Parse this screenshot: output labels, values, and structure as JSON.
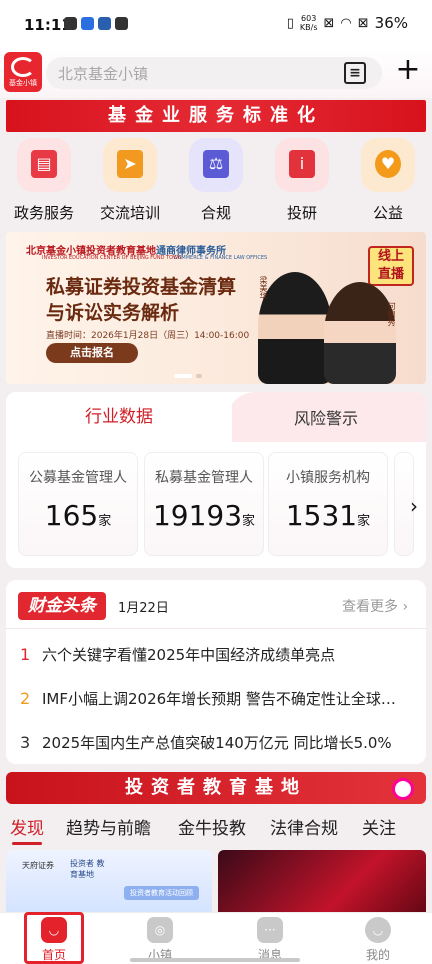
{
  "status_bar": {
    "time": "11:11",
    "net_speed_top": "603",
    "net_speed_unit": "KB/s",
    "battery": "36%"
  },
  "header": {
    "logo_text": "基金小镇",
    "search_placeholder": "北京基金小镇",
    "scan_glyph": "≡",
    "plus_glyph": "+"
  },
  "service_banner": "基金业服务标准化",
  "quick_links": [
    {
      "label": "政务服务",
      "icon": "document-person-icon",
      "color": "#e83a44"
    },
    {
      "label": "交流培训",
      "icon": "blackboard-icon",
      "color": "#f19a1f"
    },
    {
      "label": "合规",
      "icon": "scale-shield-icon",
      "color": "#5b5bd6"
    },
    {
      "label": "投研",
      "icon": "book-info-icon",
      "color": "#e2323c"
    },
    {
      "label": "公益",
      "icon": "heart-icon",
      "color": "#f39a1b"
    }
  ],
  "promo": {
    "org_left": "北京基金小镇投资者教育基地",
    "org_left_sub": "INVESTOR EDUCATION CENTER OF BEIJING FUND TOWN",
    "org_right": "通商律师事务所",
    "org_right_sub": "COMMERCE & FINANCE LAW OFFICES",
    "title_line1": "私募证券投资基金清算",
    "title_line2": "与诉讼实务解析",
    "date_line": "直播时间：2026年1月28日（周三）14:00-16:00",
    "cta": "点击报名",
    "badge": "线上 直播",
    "speaker1": "梁美华",
    "speaker2": "何锦秀"
  },
  "industry": {
    "tab_active": "行业数据",
    "tab_other": "风险警示",
    "stats": [
      {
        "label": "公募基金管理人",
        "value": "165",
        "unit": "家"
      },
      {
        "label": "私募基金管理人",
        "value": "19193",
        "unit": "家"
      },
      {
        "label": "小镇服务机构",
        "value": "1531",
        "unit": "家"
      }
    ]
  },
  "news": {
    "brand": "财金头条",
    "date": "1月22日",
    "more": "查看更多 ›",
    "items": [
      {
        "rank": "1",
        "rank_color": "#e1272f",
        "title": "六个关键字看懂2025年中国经济成绩单亮点"
      },
      {
        "rank": "2",
        "rank_color": "#f19a1f",
        "title": "IMF小幅上调2026年增长预期 警告不确定性让全球…"
      },
      {
        "rank": "3",
        "rank_color": "#333333",
        "title": "2025年国内生产总值突破140万亿元 同比增长5.0%"
      }
    ]
  },
  "edu_banner": "投资者教育基地",
  "edu_tabs": [
    "发现",
    "趋势与前瞻",
    "金牛投教",
    "法律合规",
    "关注"
  ],
  "thumbs": {
    "card1_brand": "天府证券",
    "card1_tag": "投资者 教育基地",
    "card1_btn": "投资者教育活动回顾"
  },
  "bottom_nav": [
    {
      "label": "首页",
      "active": true
    },
    {
      "label": "小镇",
      "active": false
    },
    {
      "label": "消息",
      "active": false
    },
    {
      "label": "我的",
      "active": false
    }
  ]
}
